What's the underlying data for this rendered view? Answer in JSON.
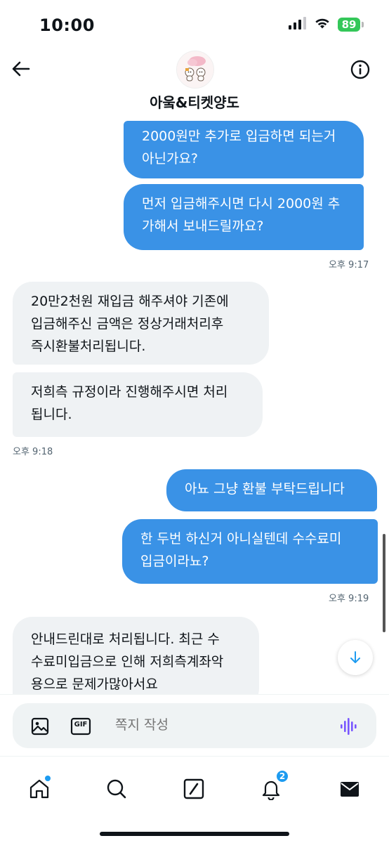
{
  "status_bar": {
    "time": "10:00",
    "battery": "89",
    "battery_color": "#34c759",
    "icons": [
      "signal-icon",
      "wifi-icon",
      "battery-icon"
    ]
  },
  "header": {
    "back_icon": "arrow-left-icon",
    "title": "아웈&티켓양도",
    "info_icon": "info-icon"
  },
  "messages": [
    {
      "side": "sent",
      "lines": [
        "2000원만 추가로 입금하면 되는거",
        "아닌가요?"
      ]
    },
    {
      "side": "sent",
      "lines": [
        "먼저 입금해주시면 다시 2000원 추",
        "가해서 보내드릴까요?"
      ]
    },
    {
      "timestamp": "오후 9:17"
    },
    {
      "side": "received",
      "lines": [
        "20만2천원 재입금 해주셔야 기존에",
        "입금해주신 금액은 정상거래처리후",
        "즉시환불처리됩니다."
      ]
    },
    {
      "side": "received",
      "lines": [
        "저희측 규정이라 진행해주시면 처리",
        "됩니다."
      ]
    },
    {
      "timestamp": "오후 9:18"
    },
    {
      "side": "sent",
      "lines": [
        "아뇨 그냥 환불 부탁드립니다"
      ]
    },
    {
      "side": "sent",
      "lines": [
        "한 두번 하신거 아니실텐데 수수료미",
        "입금이라뇨?"
      ]
    },
    {
      "timestamp": "오후 9:19"
    },
    {
      "side": "received",
      "lines": [
        "안내드린대로 처리됩니다. 최근 수",
        "수료미입금으로 인해 저희측계좌악",
        "용으로 문제가많아서요"
      ]
    }
  ],
  "composer": {
    "placeholder": "쪽지 작성",
    "image_icon": "image-icon",
    "gif_label": "GIF",
    "voice_icon": "voice-waveform-icon",
    "voice_color": "#7856ff"
  },
  "nav": {
    "items": [
      "home-icon",
      "search-icon",
      "grok-icon",
      "notifications-icon",
      "messages-icon"
    ],
    "notification_count": "2"
  },
  "colors": {
    "sent_bubble": "#3a92e6",
    "received_bubble": "#eff2f4",
    "accent": "#1d9bf0"
  }
}
